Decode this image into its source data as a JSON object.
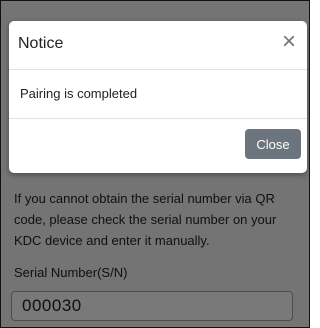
{
  "page": {
    "help_text": "If you cannot obtain the serial number via QR code, please check the serial number on your KDC device and enter it manually.",
    "serial_label": "Serial Number(S/N)",
    "serial_value": "000030"
  },
  "modal": {
    "title": "Notice",
    "close_icon": "close-icon",
    "close_symbol": "×",
    "message": "Pairing is completed",
    "close_button_label": "Close"
  },
  "colors": {
    "close_button_bg": "#6c757d",
    "overlay": "rgba(0,0,0,0.5)"
  }
}
